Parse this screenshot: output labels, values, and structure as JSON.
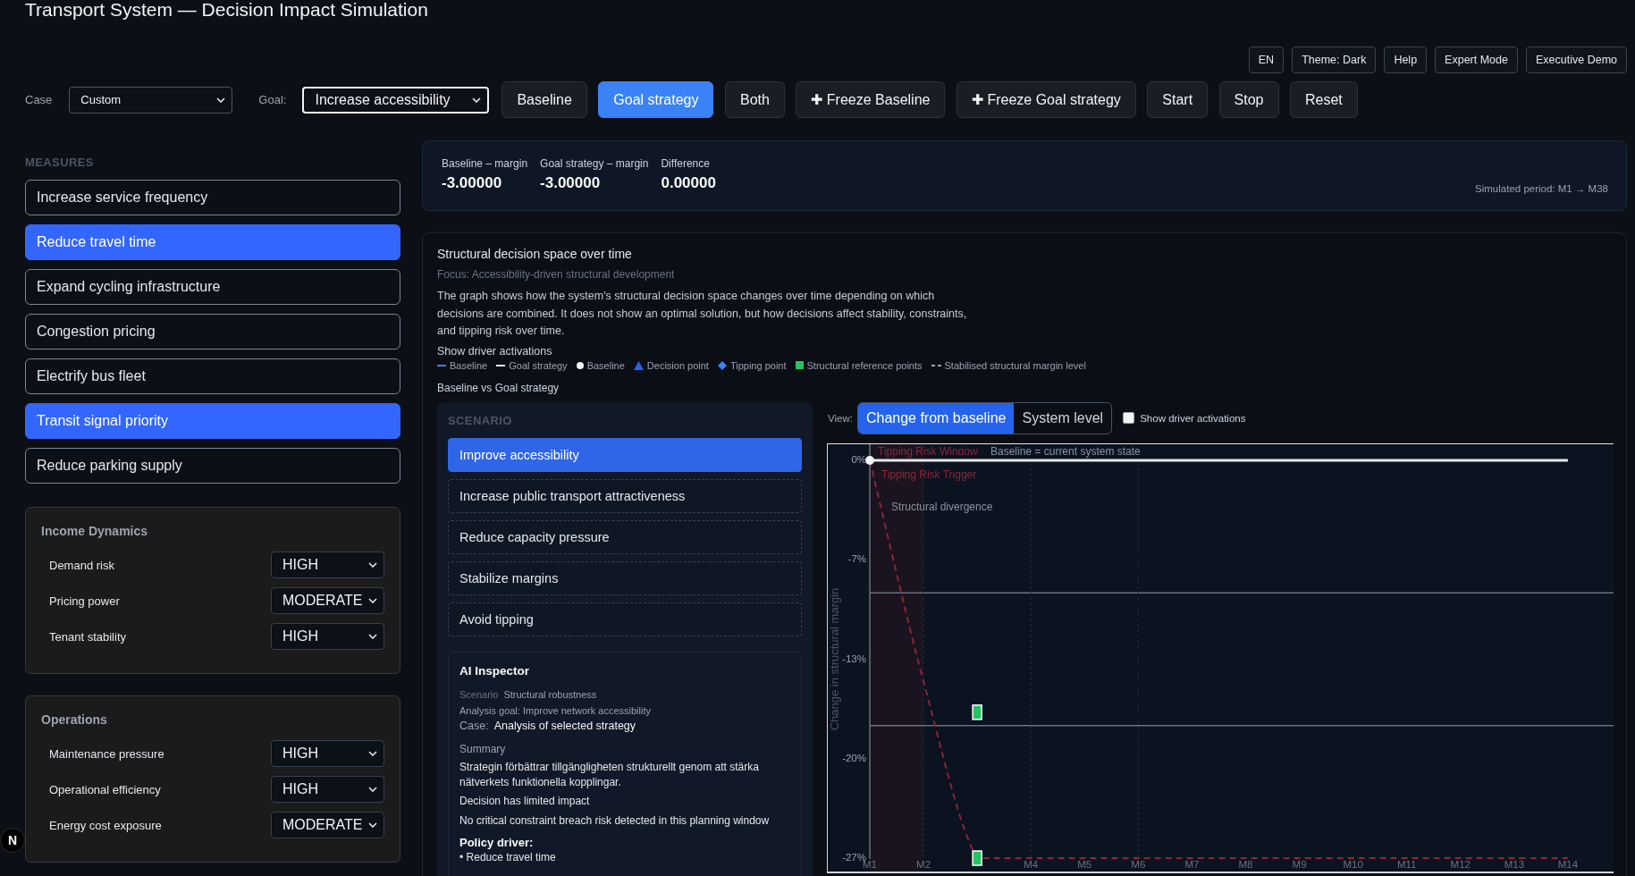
{
  "header": {
    "title": "Transport System — Decision Impact Simulation"
  },
  "utility_buttons": [
    {
      "label": "EN"
    },
    {
      "label": "Theme: Dark"
    },
    {
      "label": "Help"
    },
    {
      "label": "Expert Mode"
    },
    {
      "label": "Executive Demo"
    }
  ],
  "toolbar": {
    "case": {
      "label": "Case",
      "value": "Custom"
    },
    "goal": {
      "label": "Goal:",
      "value": "Increase accessibility",
      "focused": true
    },
    "modes": [
      {
        "label": "Baseline",
        "selected": false
      },
      {
        "label": "Goal strategy",
        "selected": true
      },
      {
        "label": "Both",
        "selected": false
      }
    ],
    "actions": [
      {
        "label": "✚ Freeze Baseline"
      },
      {
        "label": "✚ Freeze Goal strategy"
      },
      {
        "label": "Start"
      },
      {
        "label": "Stop"
      },
      {
        "label": "Reset"
      }
    ]
  },
  "measures": {
    "title": "MEASURES",
    "items": [
      {
        "label": "Increase service frequency",
        "selected": false
      },
      {
        "label": "Reduce travel time",
        "selected": true
      },
      {
        "label": "Expand cycling infrastructure",
        "selected": false
      },
      {
        "label": "Congestion pricing",
        "selected": false
      },
      {
        "label": "Electrify bus fleet",
        "selected": false
      },
      {
        "label": "Transit signal priority",
        "selected": true
      },
      {
        "label": "Reduce parking supply",
        "selected": false
      }
    ]
  },
  "parameter_groups": [
    {
      "title": "Income Dynamics",
      "parameters": [
        {
          "label": "Demand risk",
          "value": "HIGH"
        },
        {
          "label": "Pricing power",
          "value": "MODERATE"
        },
        {
          "label": "Tenant stability",
          "value": "HIGH"
        }
      ]
    },
    {
      "title": "Operations",
      "parameters": [
        {
          "label": "Maintenance pressure",
          "value": "HIGH"
        },
        {
          "label": "Operational efficiency",
          "value": "HIGH"
        },
        {
          "label": "Energy cost exposure",
          "value": "MODERATE"
        }
      ]
    }
  ],
  "summary": {
    "metrics": [
      {
        "label": "Baseline – margin",
        "value": "-3.00000"
      },
      {
        "label": "Goal strategy – margin",
        "value": "-3.00000"
      },
      {
        "label": "Difference",
        "value": "0.00000"
      }
    ],
    "period": "Simulated period: M1 → M38"
  },
  "chart_panel": {
    "title": "Structural decision space over time",
    "focus": "Focus: Accessibility-driven structural development",
    "description": "The graph shows how the system's structural decision space changes over time depending on which decisions are combined. It does not show an optimal solution, but how decisions affect stability, constraints, and tipping risk over time.",
    "driver_note": "Show driver activations",
    "legend": [
      {
        "kind": "line",
        "label": "Baseline",
        "color": "#3b82f6"
      },
      {
        "kind": "series"
      },
      {
        "kind": "dot",
        "label": "Baseline",
        "color": "#f3f4f6"
      },
      {
        "kind": "triangle",
        "label": "Decision point",
        "color": "#2563eb"
      },
      {
        "kind": "diamond",
        "label": "Tipping point",
        "color": "#3b82f6"
      },
      {
        "kind": "series"
      },
      {
        "kind": "dashed",
        "label": "Stabilised structural margin level",
        "color": "#9ca3af"
      }
    ],
    "comparison": "Baseline vs Goal strategy",
    "scenario": {
      "title": "SCENARIO",
      "items": [
        {
          "label": "Improve accessibility",
          "selected": true
        },
        {
          "label": "Increase public transport attractiveness",
          "selected": false
        },
        {
          "label": "Reduce capacity pressure",
          "selected": false
        },
        {
          "label": "Stabilize margins",
          "selected": false
        },
        {
          "label": "Avoid tipping",
          "selected": false
        }
      ]
    },
    "inspector": {
      "title": "AI Inspector",
      "scenario": {
        "label": "Scenario",
        "value": "Structural robustness"
      },
      "analysis_goal": "Analysis goal: Improve network accessibility",
      "case": {
        "label": "Case:",
        "value": "Analysis of selected strategy"
      },
      "summary_title": "Summary",
      "summary": [
        "Strategin förbättrar tillgängligheten strukturellt genom att stärka nätverkets funktionella kopplingar.",
        "Decision has limited impact",
        "No critical constraint breach risk detected in this planning window"
      ],
      "policy_title": "Policy driver:",
      "policy_items": [
        "• Reduce travel time"
      ]
    },
    "view": {
      "label": "View:",
      "options": [
        {
          "label": "Change from baseline",
          "selected": true
        },
        {
          "label": "System level",
          "selected": false
        }
      ],
      "driver_activations": {
        "label": "Show driver activations",
        "checked": false
      }
    },
    "chart_data": {
      "type": "line",
      "ylabel": "Change in structural margin",
      "categories": [
        "M1",
        "M2",
        null,
        "M4",
        "M5",
        "M6",
        "M7",
        "M8",
        "M9",
        "M10",
        "M11",
        "M12",
        "M13",
        "M14"
      ],
      "ylim": [
        -27,
        0
      ],
      "yticks": [
        {
          "value": 0,
          "label": "0%"
        },
        {
          "value": -6.75,
          "label": "-7%"
        },
        {
          "value": -13.5,
          "label": "-13%"
        },
        {
          "value": -20.25,
          "label": "-20%"
        },
        {
          "value": -27,
          "label": "-27%"
        }
      ],
      "series": [
        {
          "name": "Goal strategy",
          "color": "#e5e7eb",
          "line_style": "solid",
          "values": [
            0,
            0,
            0,
            0,
            0,
            0,
            0,
            0,
            0,
            0,
            0,
            0,
            0,
            0
          ]
        },
        {
          "color": "#8b2636",
          "line_style": "dashed",
          "values": [
            0,
            -15,
            -27,
            -27,
            -27,
            -27,
            -27,
            -27,
            -27,
            -27,
            -27,
            -27,
            -27,
            -27
          ]
        },
        {
          "name": "Structural reference points",
          "color": "#22c55e",
          "line_style": "none",
          "marker": "square",
          "values": [
            null,
            null,
            -17.1,
            null,
            null,
            null,
            null,
            null,
            null,
            null,
            null,
            null,
            null,
            null
          ]
        },
        {
          "color": "#22c55e",
          "line_style": "none",
          "marker": "square",
          "values": [
            null,
            null,
            -27,
            null,
            null,
            null,
            null,
            null,
            null,
            null,
            null,
            null,
            null,
            null
          ]
        }
      ],
      "bands": [
        {
          "axis": "x",
          "from": "M1",
          "to": "M2",
          "label": "Tipping Risk Window"
        }
      ],
      "ref_lines": [
        {
          "axis": "y",
          "value": -9
        },
        {
          "axis": "y",
          "value": -18
        },
        {
          "axis": "x",
          "value": "M2"
        },
        {
          "axis": "x",
          "value": "M4"
        },
        {
          "axis": "x",
          "value": "M6"
        }
      ],
      "annotations": [
        "Baseline = current system state",
        "Tipping Risk Trigger",
        "Structural divergence"
      ]
    }
  },
  "dev_badge": {
    "label": "N"
  }
}
